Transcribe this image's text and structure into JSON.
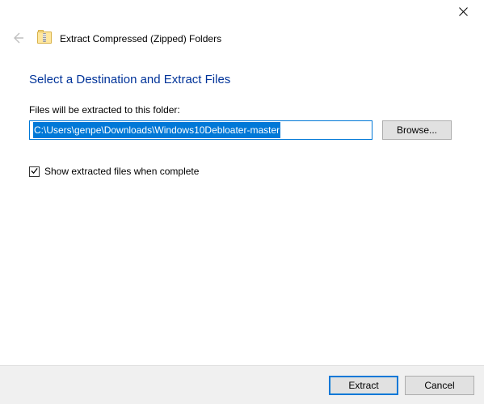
{
  "window": {
    "title": "Extract Compressed (Zipped) Folders"
  },
  "main": {
    "instruction": "Select a Destination and Extract Files",
    "field_label": "Files will be extracted to this folder:",
    "path_value": "C:\\Users\\genpe\\Downloads\\Windows10Debloater-master",
    "browse_label": "Browse...",
    "show_files_label": "Show extracted files when complete",
    "show_files_checked": true
  },
  "footer": {
    "extract_label": "Extract",
    "cancel_label": "Cancel"
  }
}
